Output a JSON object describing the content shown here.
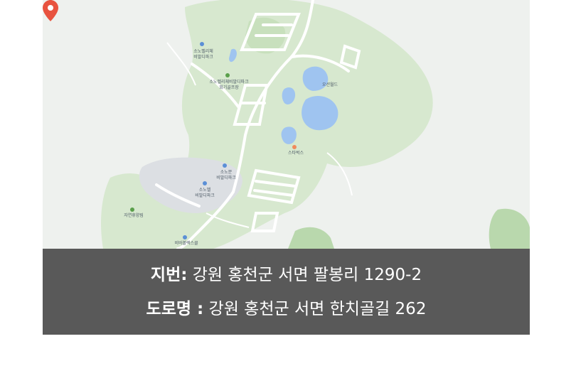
{
  "map": {
    "colors": {
      "background": "#eef1ee",
      "park": "#d7e8cf",
      "park_dark": "#b9d8ad",
      "water": "#9fc4f0",
      "road": "#ffffff",
      "built_area": "#dcdfe3",
      "pin": "#e8533f"
    },
    "pin_icon": "location-pin",
    "labels": {
      "vivaldi_park_top": "소노벨리체\n비발디파크",
      "golf": "소노벨리체비발디파크\n회기골프장",
      "ocean_world": "오션월드",
      "starbucks": "스타벅스",
      "sono_mun": "소노문\n비발디파크",
      "sono_bell": "소노벨\n비발디파크",
      "nature_trail": "자연휴양림",
      "vivaldi_bottom": "비바볼렉스클"
    }
  },
  "address": {
    "jibun_label": "지번:",
    "jibun_value": " 강원 홍천군 서면 팔봉리 1290-2",
    "road_label": "도로명 :",
    "road_value": " 강원 홍천군 서면 한치골길 262"
  }
}
